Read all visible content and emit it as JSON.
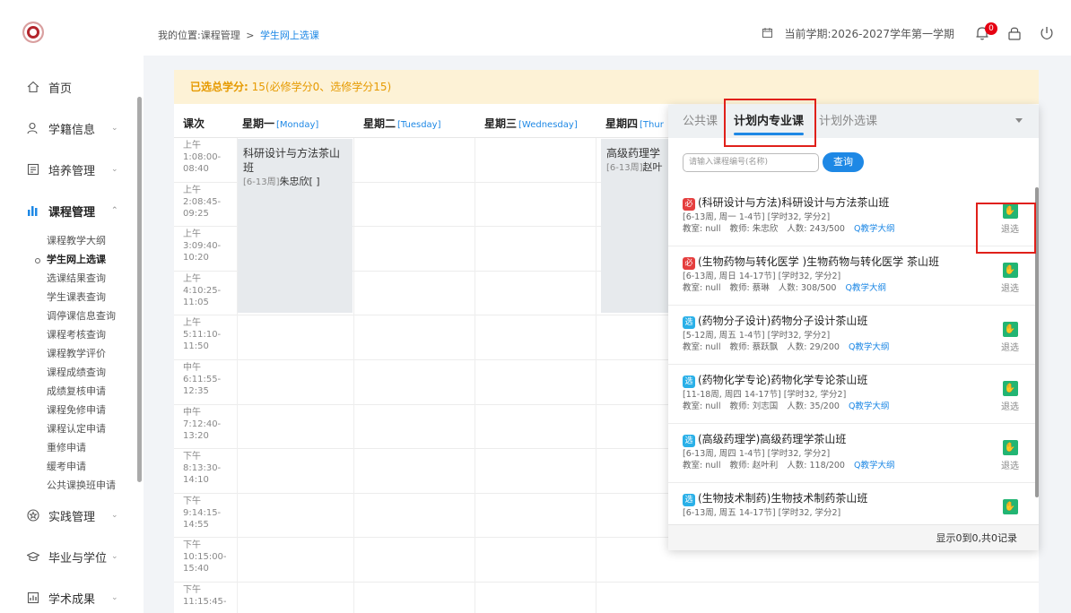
{
  "sidebar": {
    "top_items": [
      {
        "label": "首页",
        "icon": "home-icon"
      },
      {
        "label": "学籍信息",
        "icon": "person-icon"
      },
      {
        "label": "培养管理",
        "icon": "document-icon"
      }
    ],
    "course_mgmt": {
      "label": "课程管理",
      "icon": "bar-chart-icon",
      "subitems": [
        "课程教学大纲",
        "学生网上选课",
        "选课结果查询",
        "学生课表查询",
        "调停课信息查询",
        "课程考核查询",
        "课程教学评价",
        "课程成绩查询",
        "成绩复核申请",
        "课程免修申请",
        "课程认定申请",
        "重修申请",
        "缓考申请",
        "公共课换班申请"
      ]
    },
    "bottom_items": [
      {
        "label": "实践管理",
        "icon": "star-icon"
      },
      {
        "label": "毕业与学位",
        "icon": "graduation-cap-icon"
      },
      {
        "label": "学术成果",
        "icon": "report-icon"
      }
    ]
  },
  "header": {
    "breadcrumb_prefix": "我的位置:课程管理",
    "breadcrumb_sep": ">",
    "breadcrumb_current": "学生网上选课",
    "term": "当前学期:2026-2027学年第一学期",
    "notification_count": "0"
  },
  "credits": {
    "label": "已选总学分:",
    "value": "15(必修学分0、选修学分15)"
  },
  "timetable": {
    "headers": [
      {
        "cn": "课次",
        "en": ""
      },
      {
        "cn": "星期一",
        "en": "[Monday]"
      },
      {
        "cn": "星期二",
        "en": "[Tuesday]"
      },
      {
        "cn": "星期三",
        "en": "[Wednesday]"
      },
      {
        "cn": "星期四",
        "en": "[Thur"
      }
    ],
    "slots": [
      {
        "period": "上午",
        "time": "1:08:00-",
        "end": "08:40"
      },
      {
        "period": "上午",
        "time": "2:08:45-",
        "end": "09:25"
      },
      {
        "period": "上午",
        "time": "3:09:40-",
        "end": "10:20"
      },
      {
        "period": "上午",
        "time": "4:10:25-",
        "end": "11:05"
      },
      {
        "period": "上午",
        "time": "5:11:10-",
        "end": "11:50"
      },
      {
        "period": "中午",
        "time": "6:11:55-",
        "end": "12:35"
      },
      {
        "period": "中午",
        "time": "7:12:40-",
        "end": "13:20"
      },
      {
        "period": "下午",
        "time": "8:13:30-",
        "end": "14:10"
      },
      {
        "period": "下午",
        "time": "9:14:15-",
        "end": "14:55"
      },
      {
        "period": "下午",
        "time": "10:15:00-",
        "end": "15:40"
      },
      {
        "period": "下午",
        "time": "11:15:45-",
        "end": ""
      }
    ],
    "cells": {
      "monday": {
        "name": "科研设计与方法茶山班",
        "weeks": "[6-13周]",
        "teacher": "朱忠欣[ ]"
      },
      "thursday": {
        "name": "高级药理学",
        "weeks": "[6-13周]",
        "teacher": "赵叶"
      }
    }
  },
  "panel": {
    "tabs": [
      "公共课",
      "计划内专业课",
      "计划外选课"
    ],
    "search_placeholder": "请输入课程编号(名称)",
    "search_button": "查询",
    "drop_label": "退选",
    "syllabus_label": "Q教学大纲",
    "items": [
      {
        "tag": "必",
        "title": "(科研设计与方法)科研设计与方法茶山班",
        "info": "[6-13周, 周一 1-4节] [学时32, 学分2]",
        "room": "教室: null",
        "teacher": "教师: 朱忠欣",
        "count": "人数: 243/500"
      },
      {
        "tag": "必",
        "title": "(生物药物与转化医学 )生物药物与转化医学 茶山班",
        "info": "[6-13周, 周日 14-17节] [学时32, 学分2]",
        "room": "教室: null",
        "teacher": "教师: 蔡琳",
        "count": "人数: 308/500"
      },
      {
        "tag": "选",
        "title": "(药物分子设计)药物分子设计茶山班",
        "info": "[5-12周, 周五 1-4节] [学时32, 学分2]",
        "room": "教室: null",
        "teacher": "教师: 蔡跃飘",
        "count": "人数: 29/200"
      },
      {
        "tag": "选",
        "title": "(药物化学专论)药物化学专论茶山班",
        "info": "[11-18周, 周四 14-17节] [学时32, 学分2]",
        "room": "教室: null",
        "teacher": "教师: 刘志国",
        "count": "人数: 35/200"
      },
      {
        "tag": "选",
        "title": "(高级药理学)高级药理学茶山班",
        "info": "[6-13周, 周四 1-4节] [学时32, 学分2]",
        "room": "教室: null",
        "teacher": "教师: 赵叶利",
        "count": "人数: 118/200"
      },
      {
        "tag": "选",
        "title": "(生物技术制药)生物技术制药茶山班",
        "info": "[6-13周, 周五 14-17节] [学时32, 学分2]",
        "room": "",
        "teacher": "",
        "count": ""
      }
    ],
    "footer": "显示0到0,共0记录"
  }
}
